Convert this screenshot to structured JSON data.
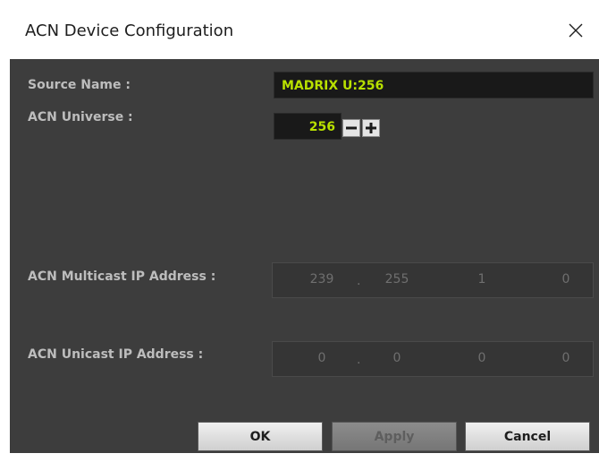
{
  "window": {
    "title": "ACN Device Configuration"
  },
  "form": {
    "source_name_label": "Source Name :",
    "source_name_value": "MADRIX U:256",
    "universe_label": "ACN Universe :",
    "universe_value": "256",
    "multicast_label": "ACN Multicast IP Address :",
    "multicast_ip": [
      "239",
      "255",
      "1",
      "0"
    ],
    "unicast_label": "ACN Unicast IP Address :",
    "unicast_ip": [
      "0",
      "0",
      "0",
      "0"
    ],
    "ip_separator": "."
  },
  "buttons": {
    "ok": "OK",
    "apply": "Apply",
    "cancel": "Cancel"
  },
  "colors": {
    "dialog_bg": "#3d3d3d",
    "value_text": "#b8e000",
    "label_text": "#bdbdbd",
    "disabled_text": "#6f6f6f"
  },
  "icons": {
    "close": "close-icon",
    "minus": "minus-icon",
    "plus": "plus-icon"
  }
}
